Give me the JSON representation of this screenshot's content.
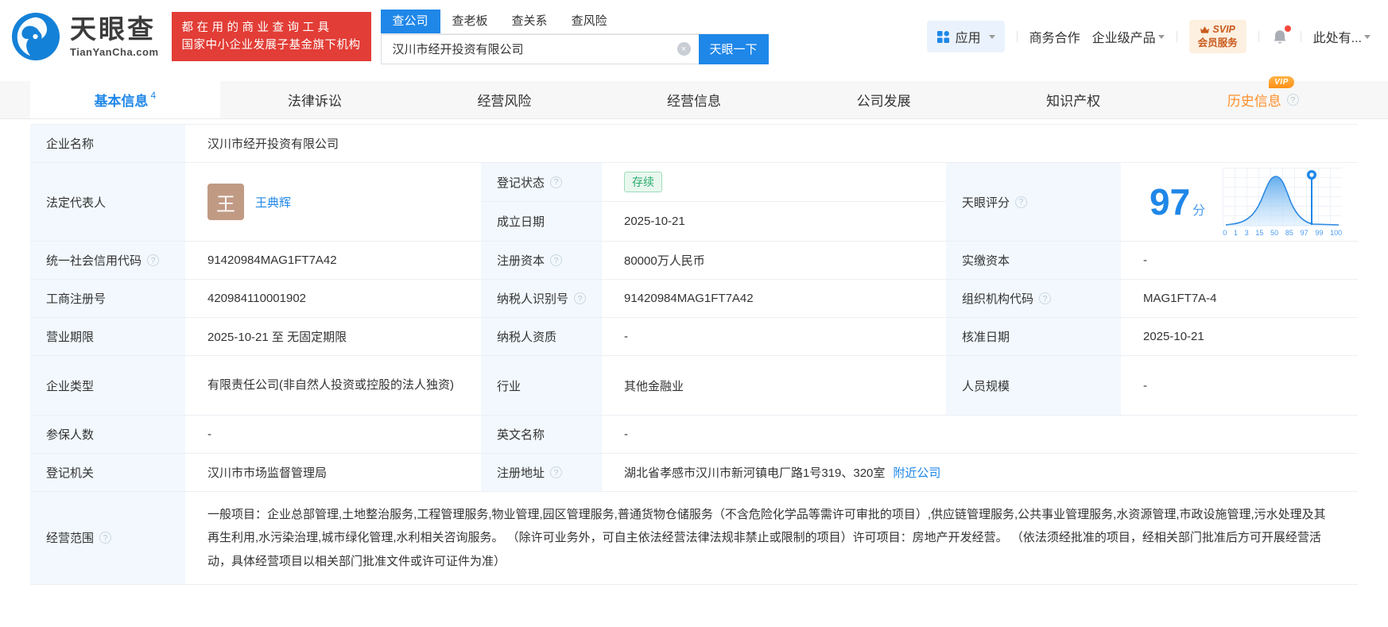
{
  "brand": {
    "name": "天眼查",
    "domain": "TianYanCha.com",
    "slogan_line1": "都在用的商业查询工具",
    "slogan_line2": "国家中小企业发展子基金旗下机构"
  },
  "search": {
    "tabs": [
      "查公司",
      "查老板",
      "查关系",
      "查风险"
    ],
    "value": "汉川市经开投资有限公司",
    "button": "天眼一下"
  },
  "nav": {
    "apps": "应用",
    "business": "商务合作",
    "enterprise": "企业级产品",
    "svip_line1": "SVIP",
    "svip_line2": "会员服务",
    "user": "此处有..."
  },
  "tabs": [
    {
      "label": "基本信息",
      "count": "4"
    },
    {
      "label": "法律诉讼"
    },
    {
      "label": "经营风险"
    },
    {
      "label": "经营信息"
    },
    {
      "label": "公司发展"
    },
    {
      "label": "知识产权"
    },
    {
      "label": "历史信息",
      "vip": "VIP"
    }
  ],
  "fields": {
    "company_name": {
      "label": "企业名称",
      "value": "汉川市经开投资有限公司"
    },
    "legal_rep": {
      "label": "法定代表人",
      "avatar": "王",
      "name": "王典辉"
    },
    "reg_status": {
      "label": "登记状态",
      "value": "存续"
    },
    "establish_date": {
      "label": "成立日期",
      "value": "2025-10-21"
    },
    "score": {
      "label": "天眼评分",
      "value": "97",
      "unit": "分",
      "ticks": [
        "0",
        "1",
        "3",
        "15",
        "50",
        "85",
        "97",
        "99",
        "100"
      ]
    },
    "credit_code": {
      "label": "统一社会信用代码",
      "value": "91420984MAG1FT7A42"
    },
    "reg_capital": {
      "label": "注册资本",
      "value": "80000万人民币"
    },
    "paid_capital": {
      "label": "实缴资本",
      "value": "-"
    },
    "reg_number": {
      "label": "工商注册号",
      "value": "420984110001902"
    },
    "taxpayer_id": {
      "label": "纳税人识别号",
      "value": "91420984MAG1FT7A42"
    },
    "org_code": {
      "label": "组织机构代码",
      "value": "MAG1FT7A-4"
    },
    "business_term": {
      "label": "营业期限",
      "value": "2025-10-21 至 无固定期限"
    },
    "taxpayer_quality": {
      "label": "纳税人资质",
      "value": "-"
    },
    "approval_date": {
      "label": "核准日期",
      "value": "2025-10-21"
    },
    "company_type": {
      "label": "企业类型",
      "value": "有限责任公司(非自然人投资或控股的法人独资)"
    },
    "industry": {
      "label": "行业",
      "value": "其他金融业"
    },
    "staff_size": {
      "label": "人员规模",
      "value": "-"
    },
    "insured_count": {
      "label": "参保人数",
      "value": "-"
    },
    "english_name": {
      "label": "英文名称",
      "value": "-"
    },
    "reg_authority": {
      "label": "登记机关",
      "value": "汉川市市场监督管理局"
    },
    "reg_address": {
      "label": "注册地址",
      "value": "湖北省孝感市汉川市新河镇电厂路1号319、320室",
      "link": "附近公司"
    },
    "business_scope": {
      "label": "经营范围",
      "value": "一般项目：企业总部管理,土地整治服务,工程管理服务,物业管理,园区管理服务,普通货物仓储服务（不含危险化学品等需许可审批的项目）,供应链管理服务,公共事业管理服务,水资源管理,市政设施管理,污水处理及其再生利用,水污染治理,城市绿化管理,水利相关咨询服务。 （除许可业务外，可自主依法经营法律法规非禁止或限制的项目）许可项目：房地产开发经营。 （依法须经批准的项目，经相关部门批准后方可开展经营活动，具体经营项目以相关部门批准文件或许可证件为准）"
    }
  }
}
